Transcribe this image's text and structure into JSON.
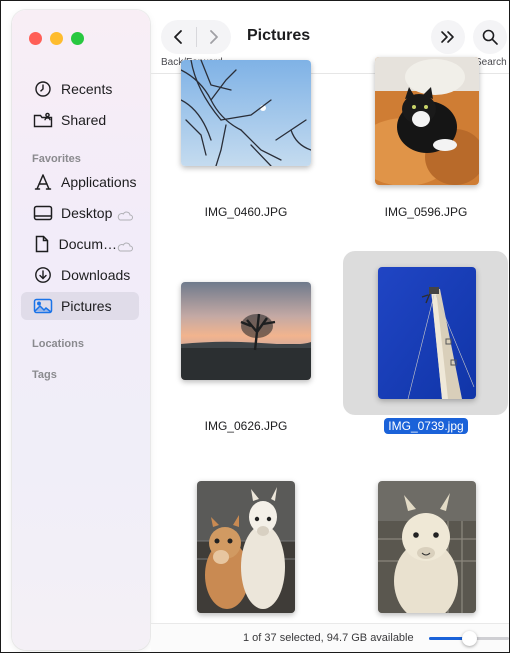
{
  "toolbar": {
    "title": "Pictures",
    "nav_caption": "Back/Forward",
    "search_caption": "Search"
  },
  "sidebar": {
    "items": [
      {
        "label": "Recents",
        "icon": "clock-icon"
      },
      {
        "label": "Shared",
        "icon": "shared-folder-icon"
      }
    ],
    "favorites_header": "Favorites",
    "favorites": [
      {
        "label": "Applications",
        "icon": "applications-icon"
      },
      {
        "label": "Desktop",
        "icon": "desktop-icon",
        "cloud": true
      },
      {
        "label": "Docum…",
        "icon": "document-icon",
        "cloud": true
      },
      {
        "label": "Downloads",
        "icon": "downloads-icon"
      },
      {
        "label": "Pictures",
        "icon": "pictures-icon",
        "selected": true
      }
    ],
    "locations_header": "Locations",
    "tags_header": "Tags"
  },
  "files": [
    {
      "name": "IMG_0460.JPG"
    },
    {
      "name": "IMG_0596.JPG"
    },
    {
      "name": "IMG_0626.JPG"
    },
    {
      "name": "IMG_0739.jpg",
      "selected": true
    },
    {
      "name": ""
    },
    {
      "name": ""
    }
  ],
  "status": {
    "text": "1 of 37 selected, 94.7 GB available",
    "zoom_level": 0.5
  },
  "colors": {
    "accent": "#1a62d9",
    "selection_bg": "#dcdcdc"
  }
}
